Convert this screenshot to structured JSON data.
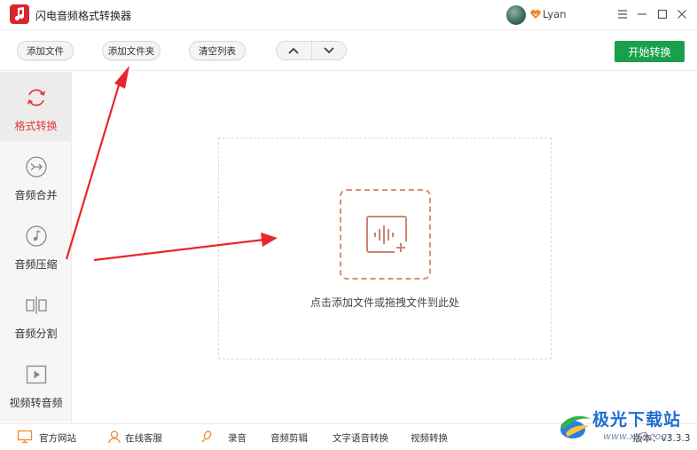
{
  "window": {
    "title": "闪电音频格式转换器",
    "username": "Lyan"
  },
  "toolbar": {
    "add_file": "添加文件",
    "add_folder": "添加文件夹",
    "clear_list": "清空列表",
    "start": "开始转换"
  },
  "sidebar": {
    "items": [
      {
        "label": "格式转换",
        "icon": "refresh-icon",
        "active": true
      },
      {
        "label": "音频合并",
        "icon": "merge-icon",
        "active": false
      },
      {
        "label": "音频压缩",
        "icon": "music-note-icon",
        "active": false
      },
      {
        "label": "音频分割",
        "icon": "split-icon",
        "active": false
      },
      {
        "label": "视频转音频",
        "icon": "play-icon",
        "active": false
      }
    ]
  },
  "main": {
    "drop_hint": "点击添加文件或拖拽文件到此处"
  },
  "footer": {
    "website": "官方网站",
    "support": "在线客服",
    "record": "录音",
    "audio_edit": "音频剪辑",
    "tts": "文字语音转换",
    "video_convert": "视频转换",
    "version": "版本：v3.3.3"
  },
  "watermark": {
    "cn": "极光下载站",
    "en": "www.xz7.com"
  },
  "colors": {
    "accent_red": "#e03a3a",
    "start_green": "#1aa04c",
    "drop_orange": "#d79178",
    "annotation_red": "#e8262a"
  }
}
